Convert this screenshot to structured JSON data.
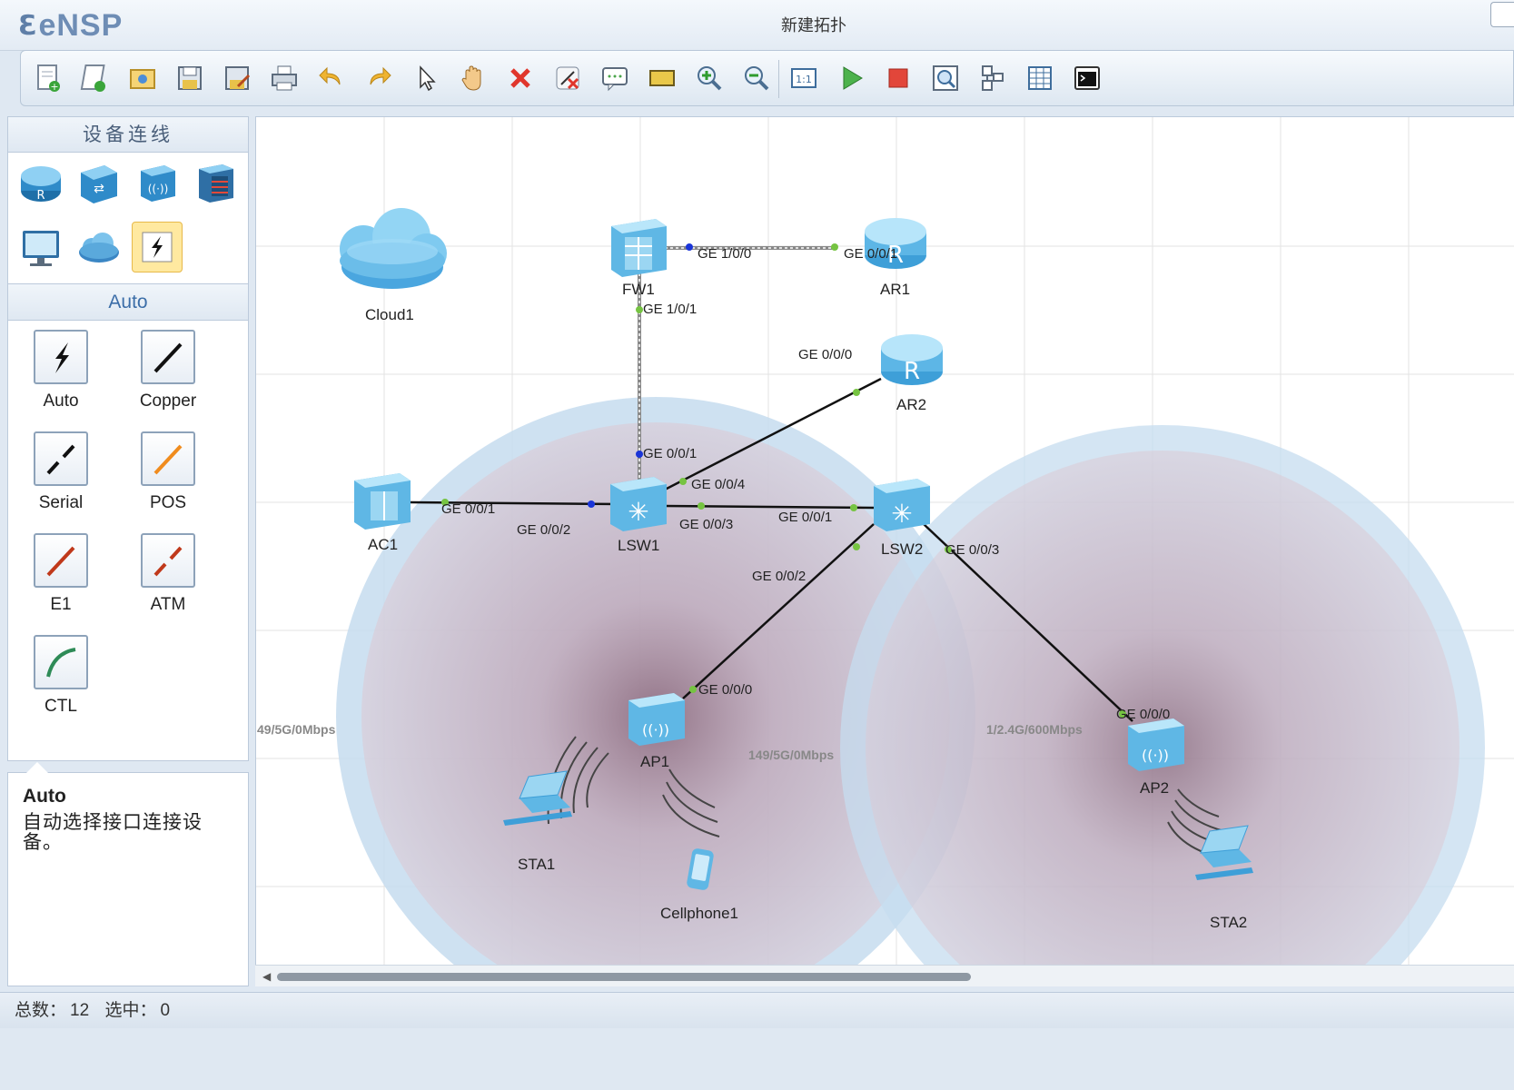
{
  "window": {
    "app_name": "eNSP",
    "title": "新建拓扑"
  },
  "toolbar": {
    "buttons": [
      {
        "name": "new-topology-button",
        "icon": "new-file-icon"
      },
      {
        "name": "new-example-button",
        "icon": "new-example-icon"
      },
      {
        "name": "open-button",
        "icon": "open-folder-icon"
      },
      {
        "name": "save-button",
        "icon": "save-icon"
      },
      {
        "name": "save-as-button",
        "icon": "save-as-icon"
      },
      {
        "name": "print-button",
        "icon": "print-icon"
      },
      {
        "name": "undo-button",
        "icon": "undo-icon"
      },
      {
        "name": "redo-button",
        "icon": "redo-icon"
      },
      {
        "name": "select-button",
        "icon": "pointer-icon"
      },
      {
        "name": "pan-button",
        "icon": "hand-icon"
      },
      {
        "name": "delete-button",
        "icon": "delete-icon"
      },
      {
        "name": "delete-link-button",
        "icon": "delete-link-icon"
      },
      {
        "name": "text-button",
        "icon": "text-note-icon"
      },
      {
        "name": "rectangle-button",
        "icon": "rectangle-icon"
      },
      {
        "name": "zoom-in-button",
        "icon": "zoom-in-icon"
      },
      {
        "name": "zoom-out-button",
        "icon": "zoom-out-icon"
      },
      {
        "name": "fit-button",
        "icon": "fit-window-icon"
      },
      {
        "name": "start-button",
        "icon": "play-icon"
      },
      {
        "name": "stop-button",
        "icon": "stop-icon"
      },
      {
        "name": "capture-button",
        "icon": "capture-icon"
      },
      {
        "name": "topology-button",
        "icon": "topology-icon"
      },
      {
        "name": "grid-button",
        "icon": "grid-icon"
      },
      {
        "name": "console-button",
        "icon": "console-icon"
      }
    ]
  },
  "left_panel": {
    "devices_header": "设备连线",
    "device_types": [
      {
        "name": "router-category",
        "icon": "router-icon"
      },
      {
        "name": "switch-category",
        "icon": "switch-icon"
      },
      {
        "name": "wlan-category",
        "icon": "wlan-icon"
      },
      {
        "name": "firewall-category",
        "icon": "firewall-icon"
      },
      {
        "name": "terminal-category",
        "icon": "pc-icon"
      },
      {
        "name": "cloud-category",
        "icon": "cloud-icon"
      },
      {
        "name": "link-category",
        "icon": "lightning-icon"
      }
    ],
    "selected_category": "Auto",
    "cables": [
      {
        "label": "Auto",
        "color": "#111111"
      },
      {
        "label": "Copper",
        "color": "#111111"
      },
      {
        "label": "Serial",
        "color": "#111111"
      },
      {
        "label": "POS",
        "color": "#f08c1e"
      },
      {
        "label": "E1",
        "color": "#c0391b"
      },
      {
        "label": "ATM",
        "color": "#c0391b"
      },
      {
        "label": "CTL",
        "color": "#2e8b57"
      }
    ],
    "description": {
      "title": "Auto",
      "text_line1": "自动选择接口连接设",
      "text_line2": "备。"
    }
  },
  "topology": {
    "devices": {
      "cloud1": "Cloud1",
      "fw1": "FW1",
      "ar1": "AR1",
      "ar2": "AR2",
      "ac1": "AC1",
      "lsw1": "LSW1",
      "lsw2": "LSW2",
      "ap1": "AP1",
      "ap2": "AP2",
      "sta1": "STA1",
      "sta2": "STA2",
      "cellphone1": "Cellphone1"
    },
    "ports": {
      "fw1_ge100": "GE 1/0/0",
      "ar1_ge001": "GE 0/0/1",
      "fw1_ge101": "GE 1/0/1",
      "ar2_ge000": "GE 0/0/0",
      "lsw1_ge001": "GE 0/0/1",
      "lsw1_ge004": "GE 0/0/4",
      "ac1_ge001": "GE 0/0/1",
      "lsw1_ge002": "GE 0/0/2",
      "lsw1_ge003": "GE 0/0/3",
      "lsw2_ge001": "GE 0/0/1",
      "lsw2_ge002": "GE 0/0/2",
      "lsw2_ge003": "GE 0/0/3",
      "ap1_ge000": "GE 0/0/0",
      "ap2_ge000": "GE 0/0/0"
    },
    "wireless": {
      "left_edge": "49/5G/0Mbps",
      "ap1": "149/5G/0Mbps",
      "ap2": "1/2.4G/600Mbps"
    }
  },
  "status": {
    "total_label": "总数：",
    "total": "12",
    "selected_label": "选中：",
    "selected": "0"
  }
}
